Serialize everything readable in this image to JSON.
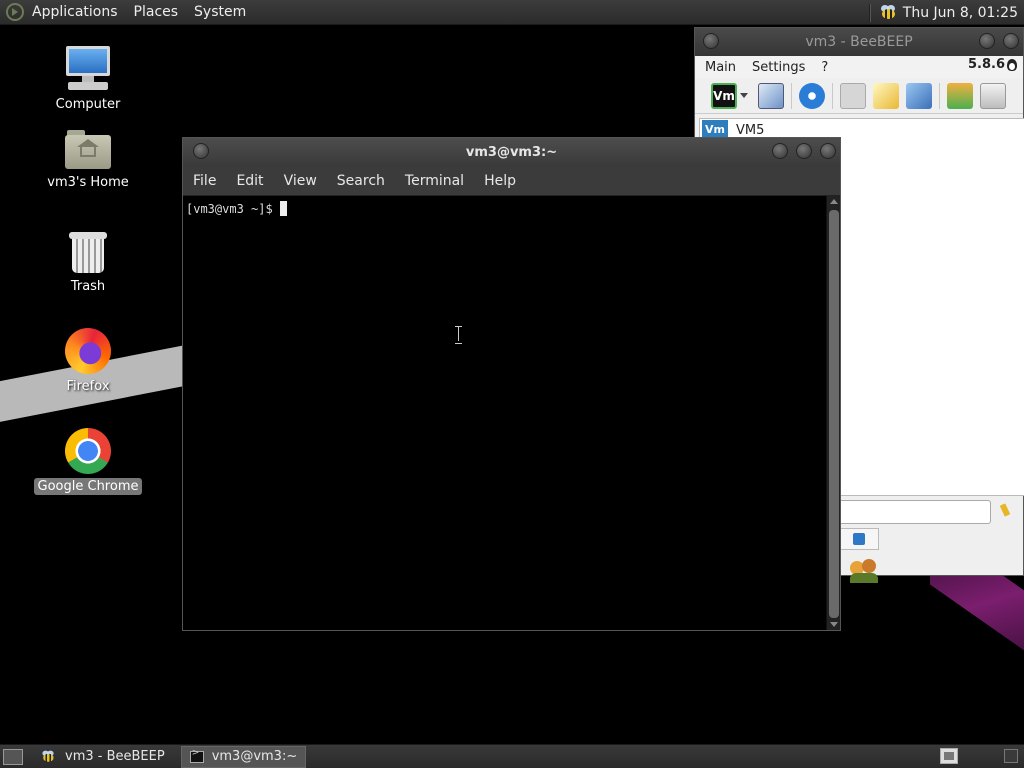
{
  "top_panel": {
    "menus": [
      "Applications",
      "Places",
      "System"
    ],
    "tray_icon": "beebeep-bee-icon",
    "clock": "Thu Jun  8, 01:25"
  },
  "desktop": {
    "icons": [
      {
        "label": "Computer",
        "icon": "computer-icon"
      },
      {
        "label": "vm3's Home",
        "icon": "home-folder-icon"
      },
      {
        "label": "Trash",
        "icon": "trash-icon"
      },
      {
        "label": "Firefox",
        "icon": "firefox-icon"
      },
      {
        "label": "Google Chrome",
        "icon": "chrome-icon",
        "selected": true
      }
    ]
  },
  "beebeep": {
    "title": "vm3 - BeeBEEP",
    "menu": [
      "Main",
      "Settings",
      "?"
    ],
    "version": "5.8.6",
    "toolbar_vm_label": "Vm",
    "user": {
      "avatar": "Vm",
      "name": "VM5"
    }
  },
  "terminal": {
    "title": "vm3@vm3:~",
    "menu": [
      "File",
      "Edit",
      "View",
      "Search",
      "Terminal",
      "Help"
    ],
    "prompt": "[vm3@vm3 ~]$"
  },
  "bottom_panel": {
    "tasks": [
      {
        "label": "vm3 - BeeBEEP",
        "icon": "beebeep-bee-icon",
        "active": false
      },
      {
        "label": "vm3@vm3:~",
        "icon": "terminal-icon",
        "active": true
      }
    ]
  },
  "colors": {
    "panel": "#2f2f2f",
    "terminal_bg": "#000000",
    "beebeep_bg": "#efefef",
    "selection": "#777777"
  }
}
